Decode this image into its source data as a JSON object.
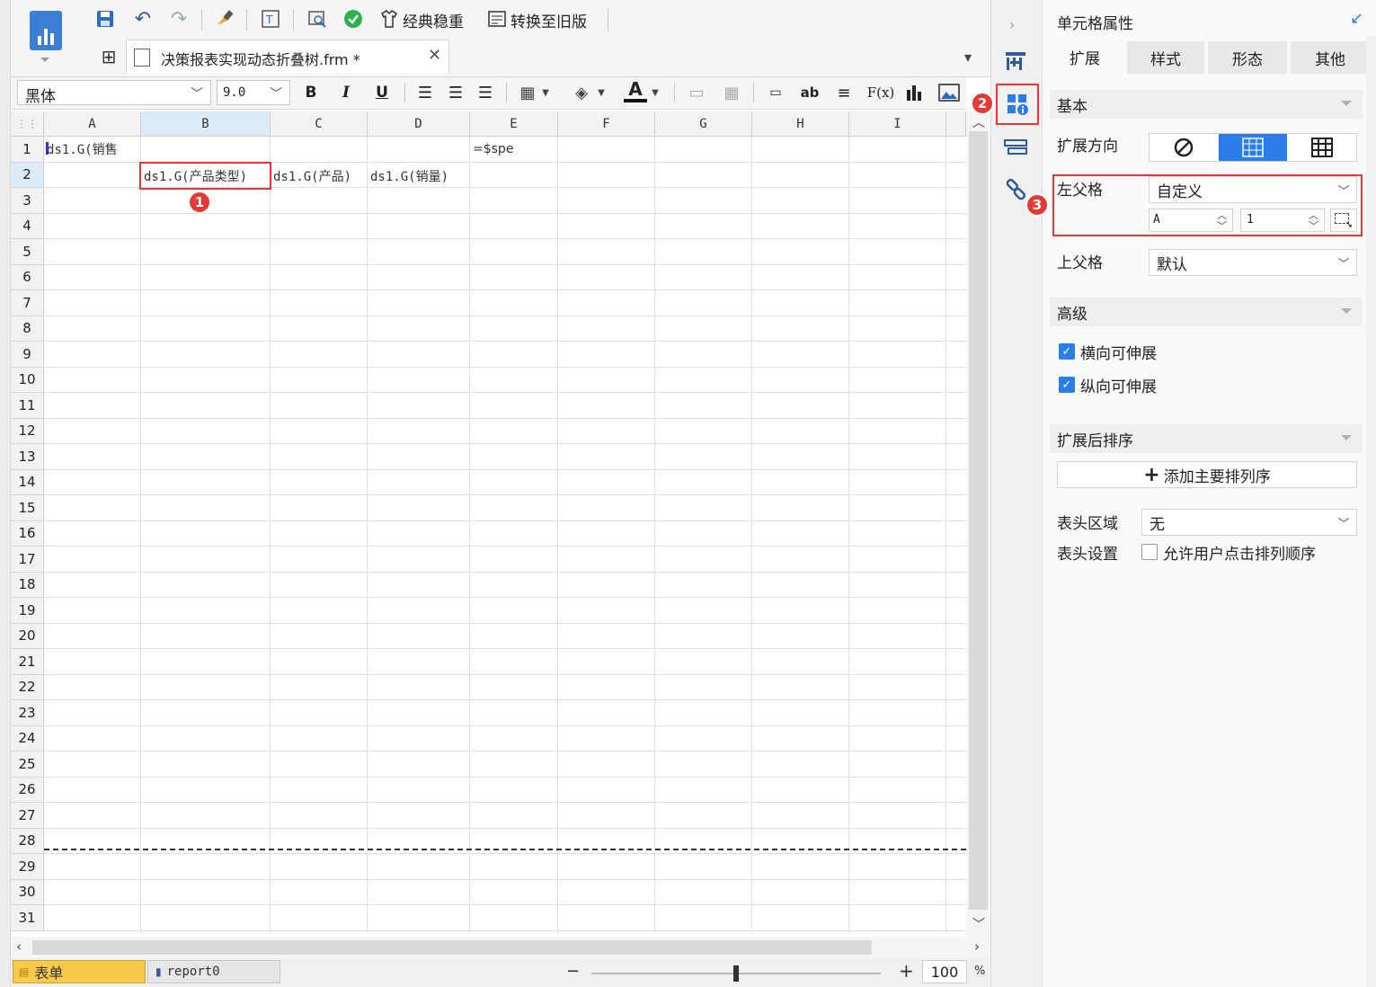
{
  "toolbar": {
    "style_label": "经典稳重",
    "convert_label": "转换至旧版"
  },
  "file_tab": {
    "name": "决策报表实现动态折叠树.frm *"
  },
  "format": {
    "font": "黑体",
    "size": "9.0"
  },
  "grid": {
    "columns": [
      "A",
      "B",
      "C",
      "D",
      "E",
      "F",
      "G",
      "H",
      "I"
    ],
    "rows": [
      "1",
      "2",
      "3",
      "4",
      "5",
      "6",
      "7",
      "8",
      "9",
      "10",
      "11",
      "12",
      "13",
      "14",
      "15",
      "16",
      "17",
      "18",
      "19",
      "20",
      "21",
      "22",
      "23",
      "24",
      "25",
      "26",
      "27",
      "28",
      "29",
      "30",
      "31"
    ],
    "cells": {
      "A1": "ds1.G(销售",
      "E1": "=$spe",
      "B2": "ds1.G(产品类型)",
      "C2": "ds1.G(产品)",
      "D2": "ds1.G(销量)"
    }
  },
  "badges": [
    "1",
    "2",
    "3"
  ],
  "sheets": {
    "sheet1": "表单",
    "sheet2": "report0"
  },
  "zoom": {
    "value": "100",
    "unit": "%",
    "level": 0.5
  },
  "panel": {
    "title": "单元格属性",
    "tabs": [
      "扩展",
      "样式",
      "形态",
      "其他"
    ],
    "basic": {
      "title": "基本",
      "expand_dir_label": "扩展方向",
      "left_parent_label": "左父格",
      "left_parent_value": "自定义",
      "left_col": "A",
      "left_row": "1",
      "up_parent_label": "上父格",
      "up_parent_value": "默认"
    },
    "advanced": {
      "title": "高级",
      "horizontal": "横向可伸展",
      "vertical": "纵向可伸展"
    },
    "sort": {
      "title": "扩展后排序",
      "add_button": "添加主要排列序"
    },
    "header_area_label": "表头区域",
    "header_area_value": "无",
    "header_setting_label": "表头设置",
    "header_setting_option": "允许用户点击排列顺序"
  }
}
